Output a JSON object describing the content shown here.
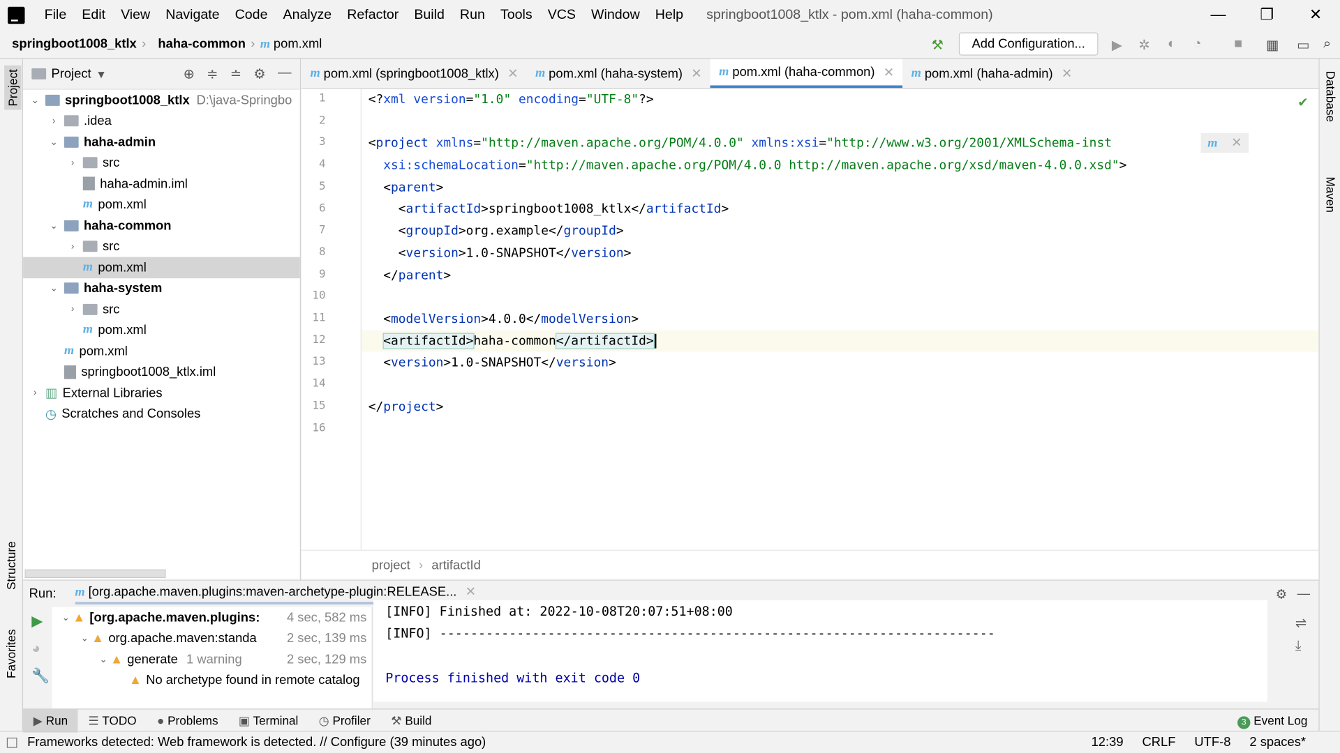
{
  "window": {
    "title": "springboot1008_ktlx - pom.xml (haha-common)",
    "controls": [
      "—",
      "❐",
      "✕"
    ]
  },
  "menu": [
    "File",
    "Edit",
    "View",
    "Navigate",
    "Code",
    "Analyze",
    "Refactor",
    "Build",
    "Run",
    "Tools",
    "VCS",
    "Window",
    "Help"
  ],
  "breadcrumb": [
    "springboot1008_ktlx",
    "haha-common",
    "pom.xml"
  ],
  "toolbar": {
    "add_configuration": "Add Configuration..."
  },
  "left_strip": {
    "project": "Project",
    "structure": "Structure",
    "favorites": "Favorites"
  },
  "right_strip": {
    "database": "Database",
    "maven": "Maven"
  },
  "project_panel": {
    "title": "Project",
    "tree": [
      {
        "label": "springboot1008_ktlx",
        "extra": "D:\\java-Springbo",
        "depth": 0,
        "arrow": "⌄",
        "type": "module",
        "bold": true
      },
      {
        "label": ".idea",
        "depth": 1,
        "arrow": "›",
        "type": "folder"
      },
      {
        "label": "haha-admin",
        "depth": 1,
        "arrow": "⌄",
        "type": "module",
        "bold": true
      },
      {
        "label": "src",
        "depth": 2,
        "arrow": "›",
        "type": "folder"
      },
      {
        "label": "haha-admin.iml",
        "depth": 2,
        "arrow": "",
        "type": "iml"
      },
      {
        "label": "pom.xml",
        "depth": 2,
        "arrow": "",
        "type": "pom"
      },
      {
        "label": "haha-common",
        "depth": 1,
        "arrow": "⌄",
        "type": "module",
        "bold": true
      },
      {
        "label": "src",
        "depth": 2,
        "arrow": "›",
        "type": "folder"
      },
      {
        "label": "pom.xml",
        "depth": 2,
        "arrow": "",
        "type": "pom",
        "selected": true
      },
      {
        "label": "haha-system",
        "depth": 1,
        "arrow": "⌄",
        "type": "module",
        "bold": true
      },
      {
        "label": "src",
        "depth": 2,
        "arrow": "›",
        "type": "folder"
      },
      {
        "label": "pom.xml",
        "depth": 2,
        "arrow": "",
        "type": "pom"
      },
      {
        "label": "pom.xml",
        "depth": 1,
        "arrow": "",
        "type": "pom"
      },
      {
        "label": "springboot1008_ktlx.iml",
        "depth": 1,
        "arrow": "",
        "type": "iml"
      },
      {
        "label": "External Libraries",
        "depth": 0,
        "arrow": "›",
        "type": "lib"
      },
      {
        "label": "Scratches and Consoles",
        "depth": 0,
        "arrow": "",
        "type": "scratch"
      }
    ]
  },
  "editor": {
    "tabs": [
      {
        "label": "pom.xml (springboot1008_ktlx)"
      },
      {
        "label": "pom.xml (haha-system)"
      },
      {
        "label": "pom.xml (haha-common)",
        "active": true
      },
      {
        "label": "pom.xml (haha-admin)"
      }
    ],
    "line_numbers": [
      "1",
      "2",
      "3",
      "4",
      "5",
      "6",
      "7",
      "8",
      "9",
      "10",
      "11",
      "12",
      "13",
      "14",
      "15",
      "16"
    ],
    "current_line": 12,
    "lines": [
      [
        [
          "pi",
          "<?"
        ],
        [
          "at",
          "xml version"
        ],
        [
          "pi",
          "="
        ],
        [
          "vl",
          "\"1.0\""
        ],
        [
          "at",
          " encoding"
        ],
        [
          "pi",
          "="
        ],
        [
          "vl",
          "\"UTF-8\""
        ],
        [
          "pi",
          "?>"
        ]
      ],
      [],
      [
        [
          "pi",
          "<"
        ],
        [
          "tg",
          "project "
        ],
        [
          "at",
          "xmlns"
        ],
        [
          "pi",
          "="
        ],
        [
          "vl",
          "\"http://maven.apache.org/POM/4.0.0\""
        ],
        [
          "at",
          " xmlns:xsi"
        ],
        [
          "pi",
          "="
        ],
        [
          "vl",
          "\"http://www.w3.org/2001/XMLSchema-inst"
        ]
      ],
      [
        [
          "pi",
          "  "
        ],
        [
          "at",
          "xsi:schemaLocation"
        ],
        [
          "pi",
          "="
        ],
        [
          "vl",
          "\"http://maven.apache.org/POM/4.0.0 http://maven.apache.org/xsd/maven-4.0.0.xsd\""
        ],
        [
          "pi",
          ">"
        ]
      ],
      [
        [
          "pi",
          "  <"
        ],
        [
          "tg",
          "parent"
        ],
        [
          "pi",
          ">"
        ]
      ],
      [
        [
          "pi",
          "    <"
        ],
        [
          "tg",
          "artifactId"
        ],
        [
          "pi",
          ">springboot1008_ktlx</"
        ],
        [
          "tg",
          "artifactId"
        ],
        [
          "pi",
          ">"
        ]
      ],
      [
        [
          "pi",
          "    <"
        ],
        [
          "tg",
          "groupId"
        ],
        [
          "pi",
          ">org.example</"
        ],
        [
          "tg",
          "groupId"
        ],
        [
          "pi",
          ">"
        ]
      ],
      [
        [
          "pi",
          "    <"
        ],
        [
          "tg",
          "version"
        ],
        [
          "pi",
          ">1.0-SNAPSHOT</"
        ],
        [
          "tg",
          "version"
        ],
        [
          "pi",
          ">"
        ]
      ],
      [
        [
          "pi",
          "  </"
        ],
        [
          "tg",
          "parent"
        ],
        [
          "pi",
          ">"
        ]
      ],
      [],
      [
        [
          "pi",
          "  <"
        ],
        [
          "tg",
          "modelVersion"
        ],
        [
          "pi",
          ">4.0.0</"
        ],
        [
          "tg",
          "modelVersion"
        ],
        [
          "pi",
          ">"
        ]
      ],
      [
        [
          "pi",
          "  "
        ],
        [
          "hl",
          "<artifactId>"
        ],
        [
          "pi",
          "haha-common"
        ],
        [
          "hl",
          "</artifactId>"
        ]
      ],
      [
        [
          "pi",
          "  <"
        ],
        [
          "tg",
          "version"
        ],
        [
          "pi",
          ">1.0-SNAPSHOT</"
        ],
        [
          "tg",
          "version"
        ],
        [
          "pi",
          ">"
        ]
      ],
      [],
      [
        [
          "pi",
          "</"
        ],
        [
          "tg",
          "project"
        ],
        [
          "pi",
          ">"
        ]
      ],
      []
    ],
    "breadcrumb": [
      "project",
      "artifactId"
    ]
  },
  "run": {
    "label": "Run:",
    "tab": "[org.apache.maven.plugins:maven-archetype-plugin:RELEASE...",
    "tree": [
      {
        "label": "[org.apache.maven.plugins:",
        "time": "4 sec, 582 ms",
        "depth": 0,
        "bold": true,
        "arrow": "⌄"
      },
      {
        "label": "org.apache.maven:standa",
        "time": "2 sec, 139 ms",
        "depth": 1,
        "arrow": "⌄"
      },
      {
        "label": "generate",
        "note": "1 warning",
        "time": "2 sec, 129 ms",
        "depth": 2,
        "arrow": "⌄"
      },
      {
        "label": "No archetype found in remote catalog",
        "time": "",
        "depth": 3,
        "arrow": ""
      }
    ],
    "console": [
      "[INFO] Finished at: 2022-10-08T20:07:51+08:00",
      "[INFO] ------------------------------------------------------------------------",
      "",
      "Process finished with exit code 0"
    ]
  },
  "bottom_tabs": [
    {
      "label": "Run",
      "active": true
    },
    {
      "label": "TODO"
    },
    {
      "label": "Problems"
    },
    {
      "label": "Terminal"
    },
    {
      "label": "Profiler"
    },
    {
      "label": "Build"
    }
  ],
  "event_log": {
    "count": "3",
    "label": "Event Log"
  },
  "status": {
    "message": "Frameworks detected: Web framework is detected. // Configure (39 minutes ago)",
    "position": "12:39",
    "line_sep": "CRLF",
    "encoding": "UTF-8",
    "indent": "2 spaces*"
  },
  "colors": {
    "accent": "#4083c9",
    "tag": "#0033b3",
    "attr": "#174ad4",
    "value": "#067d17",
    "warning": "#f0a732"
  }
}
